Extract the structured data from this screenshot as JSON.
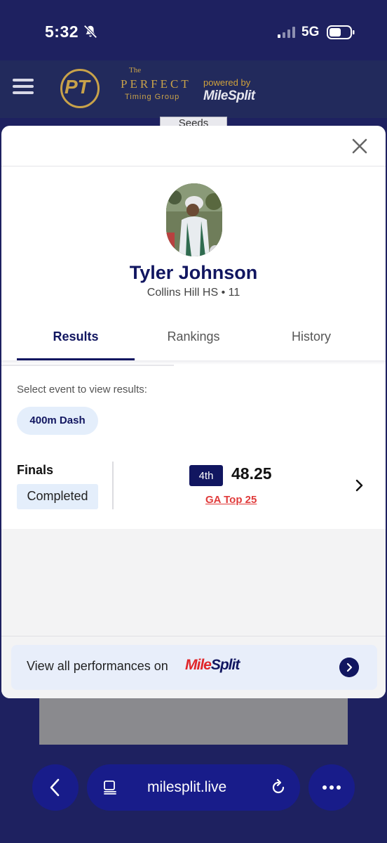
{
  "status_bar": {
    "time": "5:32",
    "network": "5G",
    "icons": [
      "bell-muted-icon",
      "signal-icon",
      "battery-icon"
    ]
  },
  "app_header": {
    "logo_the": "The",
    "logo_perfect": "PERFECT",
    "logo_timing": "Timing Group",
    "logo_monogram": "PT",
    "powered_by": "powered by",
    "milesplit": "MileSplit"
  },
  "background": {
    "seeds_tab": "Seeds"
  },
  "modal": {
    "athlete": {
      "name": "Tyler Johnson",
      "meta": "Collins Hill HS • 11"
    },
    "tabs": [
      {
        "label": "Results",
        "active": true
      },
      {
        "label": "Rankings",
        "active": false
      },
      {
        "label": "History",
        "active": false
      }
    ],
    "select_label": "Select event to view results:",
    "event_chip": "400m Dash",
    "result": {
      "round": "Finals",
      "status": "Completed",
      "place": "4th",
      "mark": "48.25",
      "ranking_link": "GA Top 25"
    },
    "footer": {
      "text": "View all performances on",
      "logo_mile": "Mile",
      "logo_split": "Split"
    }
  },
  "browser": {
    "url": "milesplit.live"
  },
  "colors": {
    "navy": "#111660",
    "status_bg": "#1e2160",
    "accent_red": "#e03b3b",
    "chip_bg": "#e4eefb",
    "gold": "#c8a24a"
  }
}
